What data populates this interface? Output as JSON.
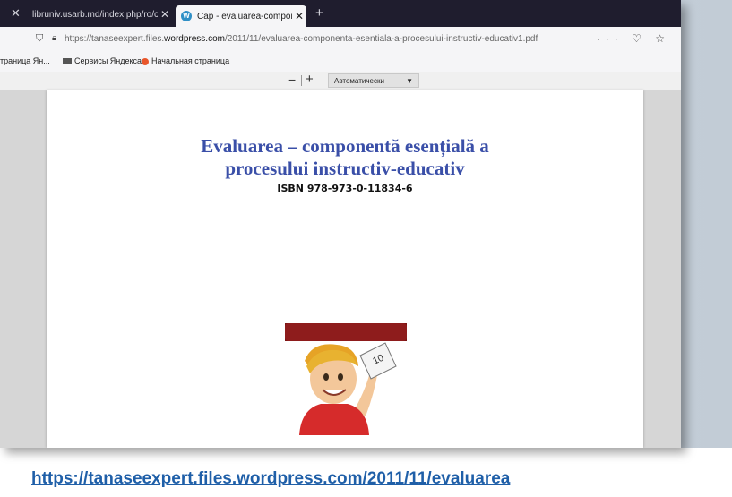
{
  "tabs": [
    {
      "label": "libruniv.usarb.md/index.php/ro/co",
      "active": false
    },
    {
      "label": "Cap - evaluarea-componenta-",
      "active": true
    }
  ],
  "address": {
    "prefix": "https://tanaseexpert.files.",
    "domain": "wordpress.com",
    "suffix": "/2011/11/evaluarea-componenta-esentiala-a-procesului-instructiv-educativ1.pdf"
  },
  "bookmarks": [
    {
      "label": "траница Ян..."
    },
    {
      "label": "Сервисы Яндекса"
    },
    {
      "label": "Начальная страница"
    }
  ],
  "pdf_toolbar": {
    "zoom_out": "−",
    "zoom_in": "+",
    "zoom_value": "Автоматически"
  },
  "document": {
    "title_line1": "Evaluarea – componentă esențială a",
    "title_line2": "procesului instructiv-educativ",
    "isbn": "ISBN 978-973-0-11834-6",
    "grade_on_paper": "10"
  },
  "caption": {
    "link": "https://tanaseexpert.files.wordpress.com/2011/11/evaluarea"
  },
  "colors": {
    "title": "#3a4fa8",
    "link": "#1f5fa8",
    "tabbar": "#1f1d2e"
  }
}
